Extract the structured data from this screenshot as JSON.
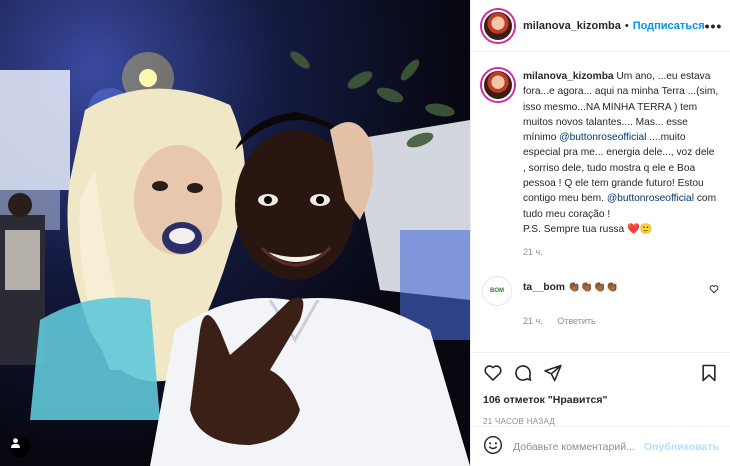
{
  "post": {
    "username": "milanova_kizomba",
    "follow_label": "Подписаться",
    "more_label": "•••"
  },
  "caption": {
    "username": "milanova_kizomba",
    "text_1": " Um ano, ...eu estava fora...e agora... aqui na minha Terra ...(sim, isso mesmo...NA MINHA TERRA ) tem muitos novos talantes.... Mas... esse mínimo ",
    "mention_1": "@buttonroseofficial",
    "text_2": " ....muito especial pra me... energia dele..., voz dele , sorriso dele, tudo mostra q ele e Boa pessoa ! Q ele tem grande futuro! Estou contigo meu bem. ",
    "mention_2": "@buttonroseofficial",
    "text_3": " com tudo meu coração !\nP.S. Sempre tua russa ❤️🙂",
    "time": "21 ч."
  },
  "comment": {
    "avatar_text": "BOM",
    "username": "ta__bom",
    "text": " 👏🏾👏🏾👏🏾👏🏾",
    "time": "21 ч.",
    "reply_label": "Ответить"
  },
  "actions": {
    "likes": "106 отметок \"Нравится\"",
    "timestamp": "21 ЧАСОВ НАЗАД"
  },
  "add_comment": {
    "placeholder": "Добавьте комментарий...",
    "publish_label": "Опубликовать"
  },
  "icons": {
    "header_more": "more-horizontal-icon",
    "like": "heart-icon",
    "comment": "comment-bubble-icon",
    "share": "paper-plane-icon",
    "save": "bookmark-icon",
    "emoji": "smiley-icon",
    "user_tag": "person-icon",
    "comment_like": "small-heart-icon"
  },
  "colors": {
    "accent": "#0095f6",
    "publish_disabled": "#b2dffc",
    "mention": "#00376b",
    "muted": "#8e8e8e"
  }
}
